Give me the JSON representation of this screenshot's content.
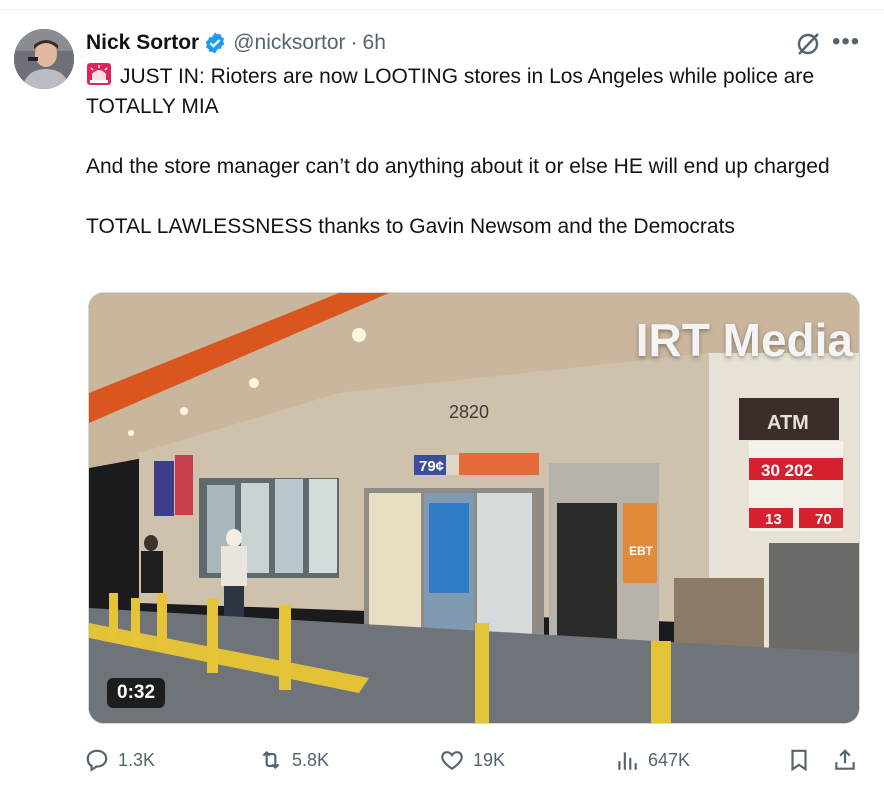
{
  "author": {
    "name": "Nick Sortor",
    "handle": "@nicksortor",
    "separator": "·",
    "time": "6h"
  },
  "tweet": {
    "line1": "JUST IN: Rioters are now LOOTING stores in Los Angeles while police are TOTALLY MIA",
    "line2": "And the store manager can’t do anything about it or else HE will end up charged",
    "line3": "TOTAL LAWLESSNESS thanks to Gavin Newsom and the Democrats"
  },
  "media": {
    "watermark": "IRT Media",
    "duration": "0:32",
    "address": "2820",
    "price": "79¢",
    "atm": "ATM",
    "ebt": "EBT",
    "gas_prices": [
      "30 202",
      "13",
      "70"
    ]
  },
  "actions": {
    "replies": "1.3K",
    "reposts": "5.8K",
    "likes": "19K",
    "views": "647K"
  },
  "icons": {
    "verified": "verified-badge-icon",
    "grok": "grok-icon",
    "more": "more-icon",
    "reply": "reply-icon",
    "repost": "repost-icon",
    "like": "heart-icon",
    "views": "views-icon",
    "bookmark": "bookmark-icon",
    "share": "share-icon",
    "siren": "siren-emoji-icon"
  },
  "colors": {
    "verified": "#1d9bf0",
    "text": "#0f1419",
    "secondary": "#536471"
  }
}
